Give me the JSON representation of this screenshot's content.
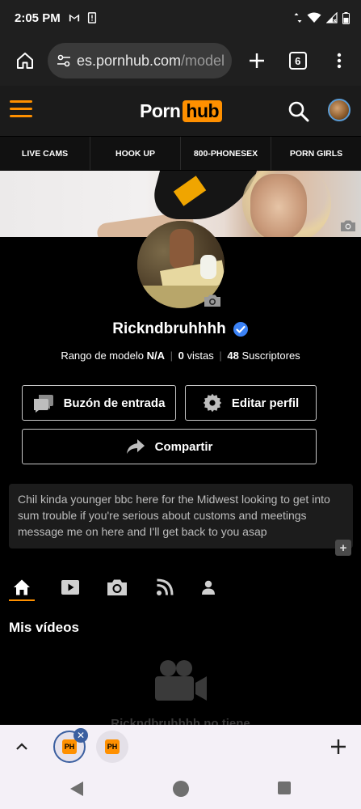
{
  "status_bar": {
    "time": "2:05 PM",
    "left_icons": [
      "gmail-icon",
      "sim-alert-icon"
    ],
    "right_icons": [
      "data-arrows-icon",
      "wifi-icon",
      "signal-icon",
      "battery-icon"
    ]
  },
  "browser": {
    "url_domain": "es.pornhub.com",
    "url_path": "/model/r",
    "tab_count": "6",
    "icons": [
      "home-icon",
      "site-settings-icon",
      "plus-icon",
      "tab-switcher-icon",
      "more-vert-icon"
    ]
  },
  "site_header": {
    "logo_left": "Porn",
    "logo_right": "hub",
    "icons": [
      "hamburger-icon",
      "search-icon",
      "avatar"
    ]
  },
  "categories": [
    "LIVE CAMS",
    "HOOK UP",
    "800-PHONESEX",
    "PORN GIRLS"
  ],
  "profile": {
    "username": "Rickndbruhhhh",
    "stats": {
      "rank_label": "Rango de modelo",
      "rank_value": "N/A",
      "views_value": "0",
      "views_label": "vistas",
      "subs_value": "48",
      "subs_label": "Suscriptores"
    }
  },
  "buttons": {
    "inbox": "Buzón de entrada",
    "edit": "Editar perfil",
    "share": "Compartir"
  },
  "bio": "Chil kinda younger bbc here for the Midwest looking to get into sum trouble if you're serious about customs and meetings message me on here and I'll get back to you asap",
  "bio_expand": "+",
  "profile_tabs": [
    "home-icon",
    "video-icon",
    "photo-icon",
    "feed-icon",
    "person-icon"
  ],
  "section_title": "Mis vídeos",
  "empty_text": "Rickndbruhhhh no tiene",
  "bottom_tabs": {
    "favicon_text": "PH",
    "close_glyph": "✕"
  },
  "colors": {
    "accent": "#ff9000",
    "verified": "#3b82f6",
    "header_bg": "#1b1b1b"
  }
}
